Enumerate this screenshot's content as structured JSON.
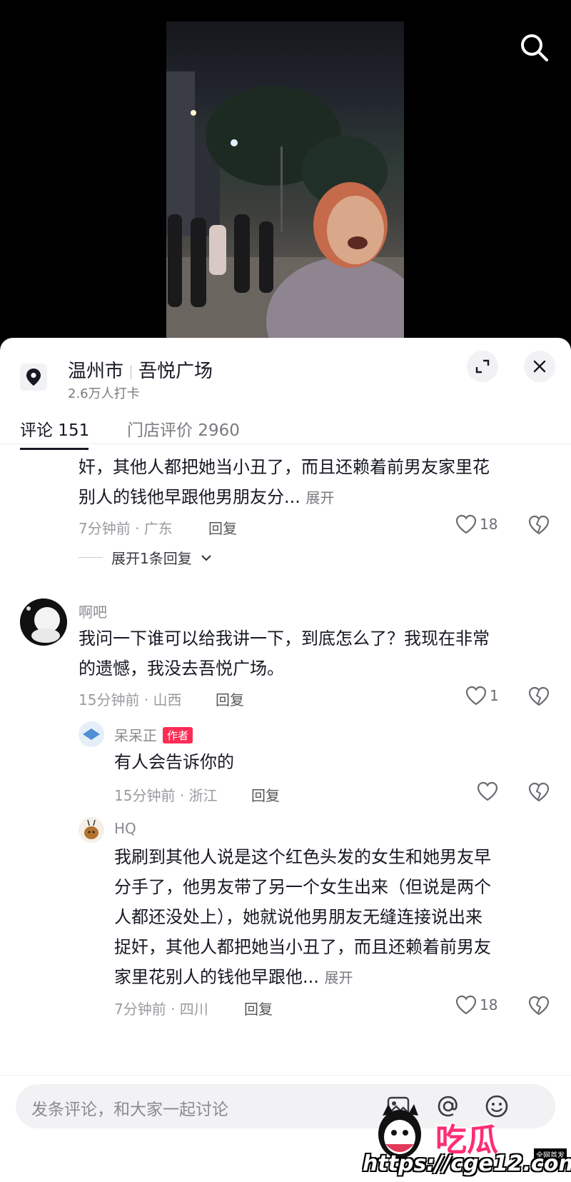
{
  "location": {
    "city": "温州市",
    "place": "吾悦广场",
    "checkins": "2.6万人打卡"
  },
  "tabs": [
    {
      "label": "评论 151",
      "active": true
    },
    {
      "label": "门店评价 2960",
      "active": false
    }
  ],
  "comments": [
    {
      "lines": [
        "奸，其他人都把她当小丑了，而且还赖着前男友家里花",
        "别人的钱他早跟他男朋友分..."
      ],
      "more_label": "展开",
      "meta": "7分钟前 · 广东",
      "reply_label": "回复",
      "likes": "18",
      "expand_replies": "展开1条回复"
    },
    {
      "user": "啊吧",
      "lines": [
        "我问一下谁可以给我讲一下，到底怎么了？我现在非常",
        "的遗憾，我没去吾悦广场。"
      ],
      "meta": "15分钟前 · 山西",
      "reply_label": "回复",
      "likes": "1",
      "replies": [
        {
          "user": "呆呆正",
          "badge": "作者",
          "lines": [
            "有人会告诉你的"
          ],
          "meta": "15分钟前 · 浙江",
          "reply_label": "回复"
        },
        {
          "user": "HQ",
          "lines": [
            "我刷到其他人说是这个红色头发的女生和她男友早",
            "分手了，他男友带了另一个女生出来（但说是两个",
            "人都还没处上），她就说他男朋友无缝连接说出来",
            "捉奸，其他人都把她当小丑了，而且还赖着前男友",
            "家里花别人的钱他早跟他..."
          ],
          "more_label": "展开",
          "meta": "7分钟前 · 四川",
          "reply_label": "回复",
          "likes": "18"
        }
      ]
    }
  ],
  "input": {
    "placeholder": "发条评论，和大家一起讨论"
  },
  "watermark": {
    "logo_text": "吃瓜",
    "badge": "全网首发",
    "url": "https://cge12.com"
  },
  "colors": {
    "accent": "#fe2c55",
    "text": "#161823",
    "muted": "#9a9ba0"
  },
  "icons": [
    "search-icon",
    "location-pin-icon",
    "expand-icon",
    "close-icon",
    "heart-icon",
    "broken-heart-icon",
    "chevron-down-icon",
    "image-icon",
    "at-icon",
    "emoji-icon"
  ]
}
